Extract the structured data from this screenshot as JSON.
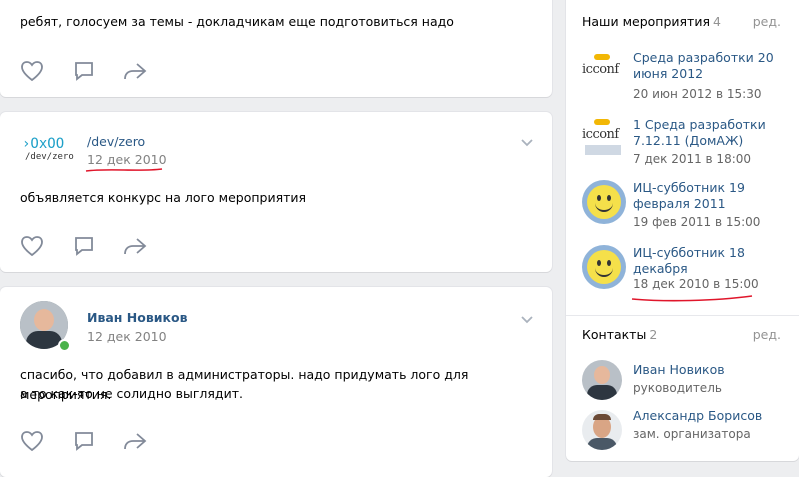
{
  "post1": {
    "text": "ребят, голосуем за темы - докладчикам еще подготовиться надо"
  },
  "post2": {
    "author": "/dev/zero",
    "logo_line1": "›OxOO",
    "logo_line2": "/dev/zero",
    "date": "12 дек 2010",
    "text": "объявляется конкурс на лого мероприятия"
  },
  "post3": {
    "author": "Иван Новиков",
    "date": "12 дек 2010",
    "text_line1": "спасибо, что добавил в администраторы. надо придумать лого для мероприятия.",
    "text_line2": "а то как-то не солидно выглядит."
  },
  "events": {
    "title": "Наши мероприятия",
    "count": "4",
    "edit": "ред.",
    "items": [
      {
        "title": "Среда разработки 20 июня 2012",
        "when": "20 июн 2012 в 15:30",
        "logo": "icconf"
      },
      {
        "title": "1 Среда разработки 7.12.11 (ДомАЖ)",
        "when": "7 дек 2011 в 18:00",
        "logo": "icconf"
      },
      {
        "title": "ИЦ-субботник 19 февраля 2011",
        "when": "19 фев 2011 в 15:00"
      },
      {
        "title": "ИЦ-субботник 18 декабря",
        "when": "18 дек 2010 в 15:00"
      }
    ]
  },
  "contacts": {
    "title": "Контакты",
    "count": "2",
    "edit": "ред.",
    "items": [
      {
        "name": "Иван Новиков",
        "role": "руководитель"
      },
      {
        "name": "Александр Борисов",
        "role": "зам. организатора"
      }
    ]
  },
  "colors": {
    "link": "#2a5885",
    "accent_red": "#e0162b",
    "icon": "#828a99",
    "online": "#4bb34b"
  }
}
